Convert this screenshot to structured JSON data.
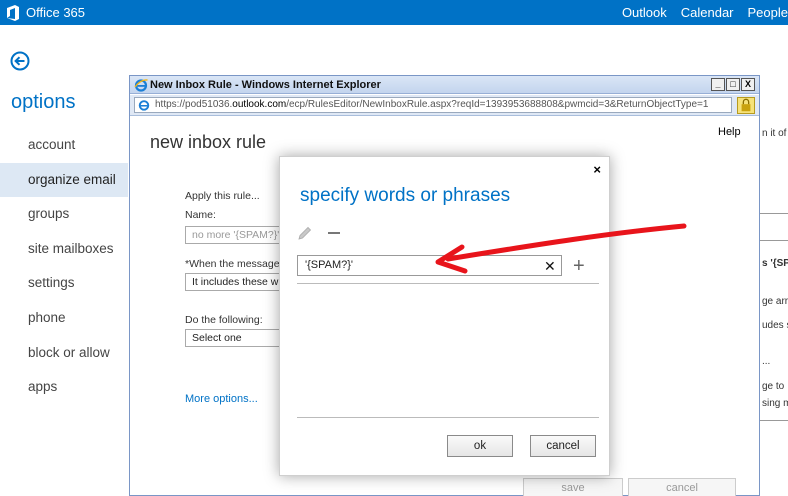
{
  "topbar": {
    "brand": "Office 365",
    "nav": [
      "Outlook",
      "Calendar",
      "People"
    ]
  },
  "sidebar": {
    "title": "options",
    "items": [
      {
        "label": "account",
        "active": false
      },
      {
        "label": "organize email",
        "active": true
      },
      {
        "label": "groups",
        "active": false
      },
      {
        "label": "site mailboxes",
        "active": false
      },
      {
        "label": "settings",
        "active": false
      },
      {
        "label": "phone",
        "active": false
      },
      {
        "label": "block or allow",
        "active": false
      },
      {
        "label": "apps",
        "active": false
      }
    ]
  },
  "background_fragments": [
    "n it of",
    "s '{SPA",
    "ge arri",
    "udes s",
    "...",
    "ge to",
    "sing m"
  ],
  "ie_window": {
    "title": "New Inbox Rule - Windows Internet Explorer",
    "window_buttons": [
      "_",
      "□",
      "X"
    ],
    "address_prefix": "https://pod51036.",
    "address_domain": "outlook.com",
    "address_suffix": "/ecp/RulesEditor/NewInboxRule.aspx?reqId=1393953688808&pwmcid=3&ReturnObjectType=1",
    "page_title": "new inbox rule",
    "help": "Help",
    "apply_label": "Apply this rule...",
    "name_label": "Name:",
    "name_value": "no more '{SPAM?}'",
    "when_label": "*When the message",
    "when_value": "It includes these w",
    "do_label": "Do the following:",
    "do_value": "Select one",
    "more_options": "More options...",
    "save_label": "save",
    "cancel_label": "cancel"
  },
  "modal": {
    "title": "specify words or phrases",
    "close": "×",
    "input_value": "'{SPAM?}'",
    "clear": "✕",
    "add": "+",
    "ok_label": "ok",
    "cancel_label": "cancel"
  },
  "colors": {
    "accent": "#0072c6",
    "annotation": "#e8141b",
    "active_nav_bg": "#dde8f4"
  }
}
